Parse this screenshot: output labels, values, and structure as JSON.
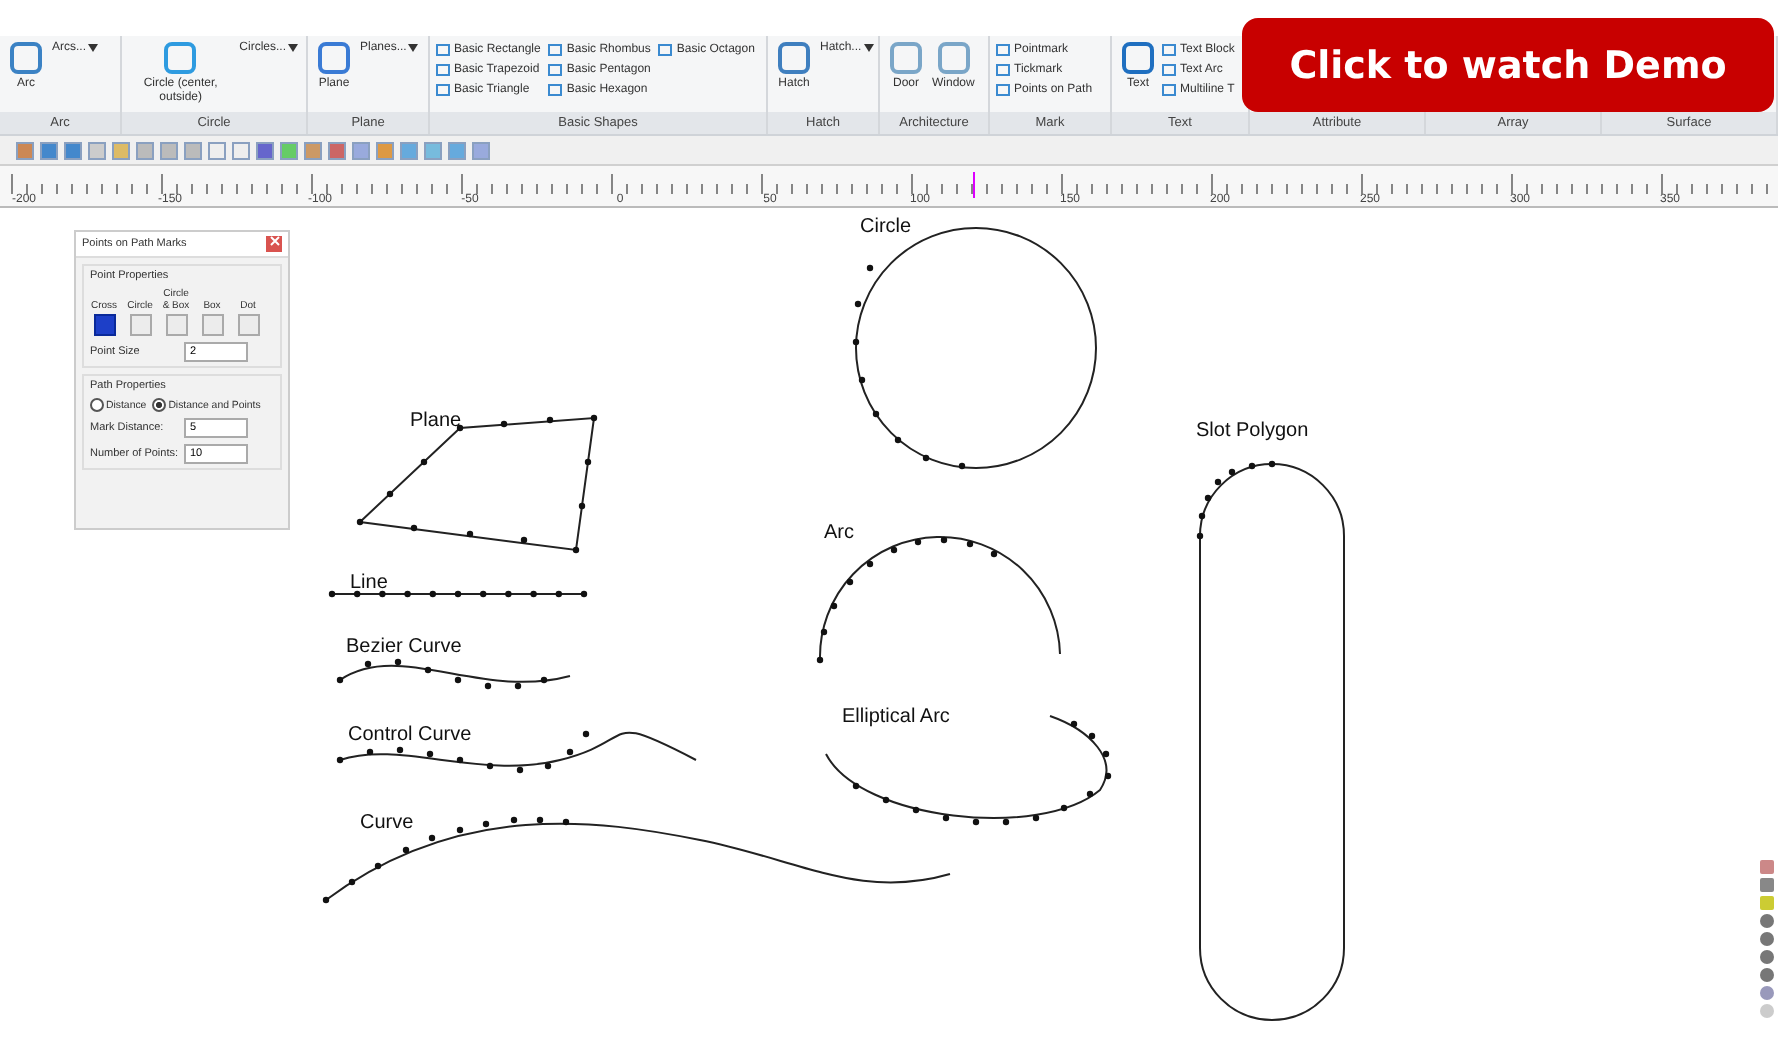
{
  "ribbon": {
    "groups": [
      {
        "label": "Arc",
        "large": [
          "Arc"
        ],
        "dropdown": "Arcs..."
      },
      {
        "label": "Circle",
        "large": [
          "Circle (center, outside)"
        ],
        "dropdown": "Circles..."
      },
      {
        "label": "Plane",
        "large": [
          "Plane"
        ],
        "dropdown": "Planes..."
      },
      {
        "label": "Basic Shapes",
        "small": [
          "Basic Rectangle",
          "Basic Trapezoid",
          "Basic Triangle",
          "Basic Rhombus",
          "Basic Pentagon",
          "Basic Hexagon",
          "Basic Octagon"
        ]
      },
      {
        "label": "Hatch",
        "large": [
          "Hatch"
        ],
        "dropdown": "Hatch..."
      },
      {
        "label": "Architecture",
        "large": [
          "Door",
          "Window"
        ]
      },
      {
        "label": "Mark",
        "small": [
          "Pointmark",
          "Tickmark",
          "Points on Path"
        ]
      },
      {
        "label": "Text",
        "large": [
          "Text"
        ],
        "small": [
          "Text Block",
          "Text Arc",
          "Multiline T"
        ]
      },
      {
        "label": "Attribute"
      },
      {
        "label": "Array"
      },
      {
        "label": "Surface"
      }
    ]
  },
  "ruler": {
    "ticks": [
      "-200",
      "-150",
      "-100",
      "-50",
      "0",
      "50",
      "100",
      "150",
      "200",
      "250",
      "300",
      "350"
    ]
  },
  "dialog": {
    "title": "Points on Path Marks",
    "point_section": "Point Properties",
    "marks": [
      {
        "label": "Cross",
        "selected": true
      },
      {
        "label": "Circle",
        "selected": false
      },
      {
        "label": "Circle & Box",
        "selected": false
      },
      {
        "label": "Box",
        "selected": false
      },
      {
        "label": "Dot",
        "selected": false
      }
    ],
    "point_size": {
      "label": "Point Size",
      "value": "2"
    },
    "path_section": "Path Properties",
    "modes": [
      {
        "label": "Distance",
        "selected": false
      },
      {
        "label": "Distance and Points",
        "selected": true
      }
    ],
    "fields": [
      {
        "label": "Mark Distance:",
        "value": "5"
      },
      {
        "label": "Number of Points:",
        "value": "10"
      }
    ]
  },
  "shapes": [
    {
      "kind": "circle",
      "label": "Circle"
    },
    {
      "kind": "plane",
      "label": "Plane"
    },
    {
      "kind": "line",
      "label": "Line"
    },
    {
      "kind": "bezier",
      "label": "Bezier Curve"
    },
    {
      "kind": "control",
      "label": "Control Curve"
    },
    {
      "kind": "curve",
      "label": "Curve"
    },
    {
      "kind": "arc",
      "label": "Arc"
    },
    {
      "kind": "ellipse",
      "label": "Elliptical Arc"
    },
    {
      "kind": "slot",
      "label": "Slot Polygon"
    }
  ],
  "demo_button": "Click to watch Demo"
}
